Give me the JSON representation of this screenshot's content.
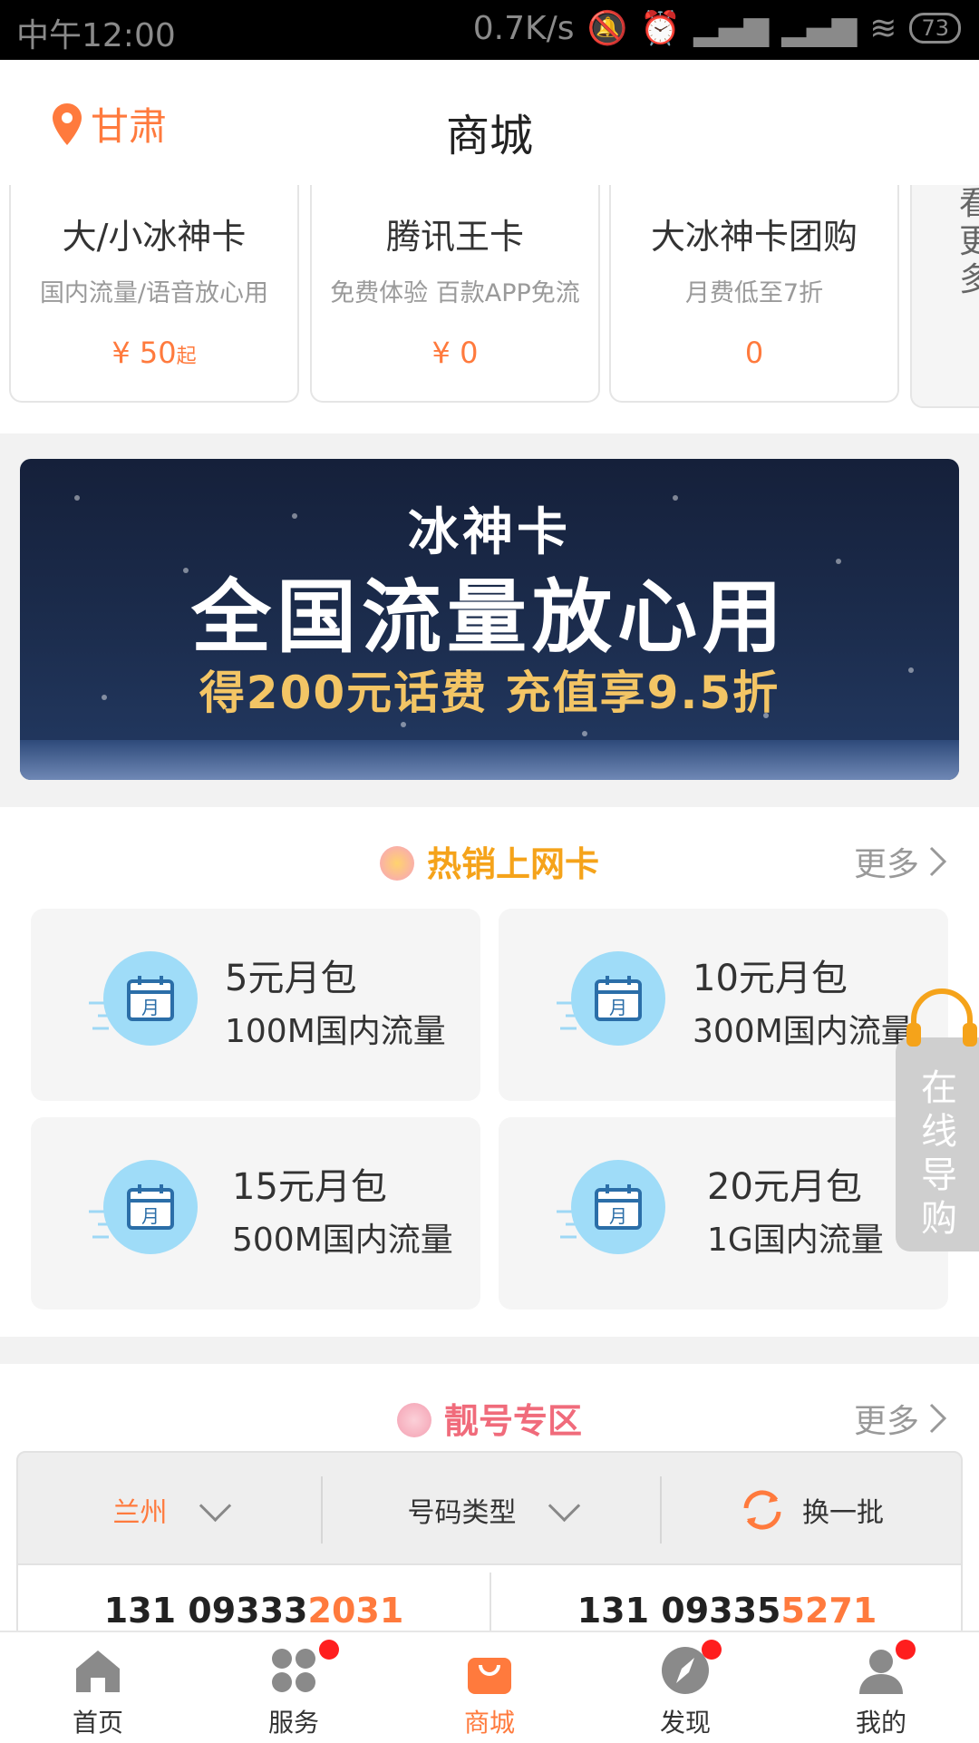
{
  "status_bar": {
    "time": "中午12:00",
    "speed": "0.7K/s",
    "battery": "73"
  },
  "header": {
    "location": "甘肃",
    "title": "商城"
  },
  "products": [
    {
      "name": "大/小冰神卡",
      "desc": "国内流量/语音放心用",
      "price": "¥ 50",
      "suffix": "起"
    },
    {
      "name": "腾讯王卡",
      "desc": "免费体验 百款APP免流",
      "price": "¥ 0",
      "suffix": ""
    },
    {
      "name": "大冰神卡团购",
      "desc": "月费低至7折",
      "price": "0",
      "suffix": ""
    }
  ],
  "more_card": {
    "label": "看更多"
  },
  "banner": {
    "line1": "冰神卡",
    "line2": "全国流量放心用",
    "line3": "得200元话费  充值享9.5折"
  },
  "hot_section": {
    "title": "热销上网卡",
    "more": "更多",
    "packages": [
      {
        "name": "5元月包",
        "detail": "100M国内流量"
      },
      {
        "name": "10元月包",
        "detail": "300M国内流量"
      },
      {
        "name": "15元月包",
        "detail": "500M国内流量"
      },
      {
        "name": "20元月包",
        "detail": "1G国内流量"
      }
    ],
    "icon_glyph": "月"
  },
  "float_button": {
    "label": "在线导购"
  },
  "number_section": {
    "title": "靓号专区",
    "more": "更多",
    "filter": {
      "city": "兰州",
      "type": "号码类型",
      "refresh": "换一批"
    },
    "numbers": [
      {
        "prefix": "131 09333",
        "suffix": "2031"
      },
      {
        "prefix": "131 09335",
        "suffix": "5271"
      }
    ]
  },
  "nav": [
    {
      "label": "首页",
      "icon": "home-icon",
      "active": false,
      "badge": false
    },
    {
      "label": "服务",
      "icon": "grid-icon",
      "active": false,
      "badge": true
    },
    {
      "label": "商城",
      "icon": "bag-icon",
      "active": true,
      "badge": false
    },
    {
      "label": "发现",
      "icon": "compass-icon",
      "active": false,
      "badge": true
    },
    {
      "label": "我的",
      "icon": "person-icon",
      "active": false,
      "badge": true
    }
  ],
  "colors": {
    "accent": "#ff7a3d",
    "hot_title": "#f5a31a",
    "number_title": "#f06b7b",
    "badge": "#ff1e1e"
  }
}
